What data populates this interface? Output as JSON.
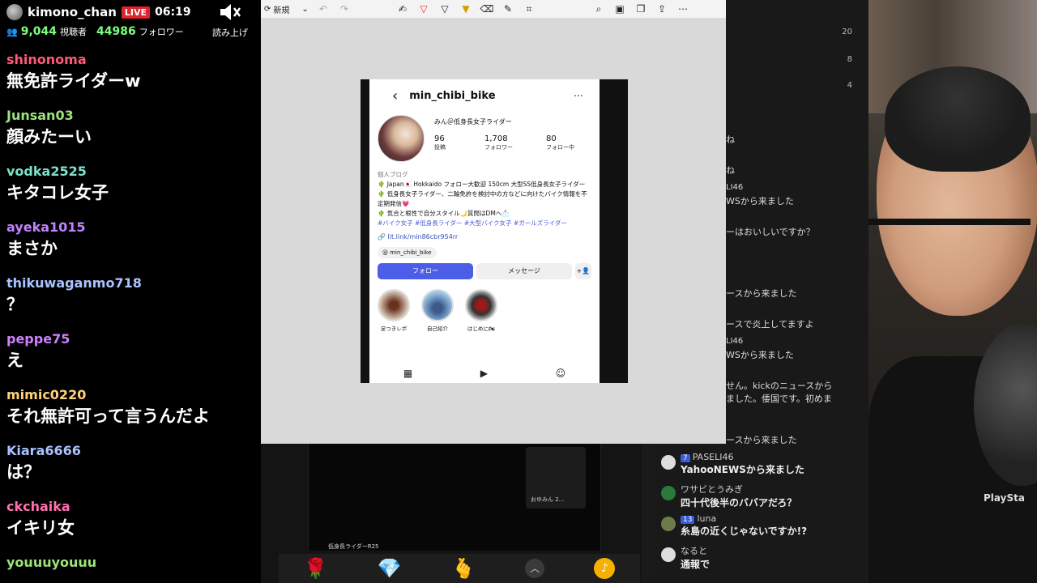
{
  "stream": {
    "streamer_name": "kimono_chan",
    "live_label": "LIVE",
    "elapsed": "06:19",
    "viewers": "9,044",
    "viewers_label": "視聴者",
    "followers": "44986",
    "followers_label": "フォロワー",
    "tts_label": "読み上げ"
  },
  "chat": [
    {
      "user": "shinonoma",
      "color": "#ff5a7a",
      "text": "無免許ライダーw"
    },
    {
      "user": "Junsan03",
      "color": "#9be37a",
      "text": "顔みたーい"
    },
    {
      "user": "vodka2525",
      "color": "#7de0c8",
      "text": "キタコレ女子"
    },
    {
      "user": "ayeka1015",
      "color": "#c080ff",
      "text": "まさか"
    },
    {
      "user": "thikuwaganmo718",
      "color": "#a8c4ff",
      "text": "？"
    },
    {
      "user": "peppe75",
      "color": "#d080ff",
      "text": "え"
    },
    {
      "user": "mimic0220",
      "color": "#ffd27a",
      "text": "それ無許可って言うんだよ"
    },
    {
      "user": "Kiara6666",
      "color": "#a8c4ff",
      "text": "は？"
    },
    {
      "user": "ckchaika",
      "color": "#ff70b0",
      "text": "イキリ女"
    },
    {
      "user": "youuuyouuu",
      "color": "#9be37a",
      "text": "…"
    }
  ],
  "editor": {
    "new_label": "新規",
    "tools": [
      "undo",
      "redo",
      "touch-write",
      "pen-red",
      "pen",
      "highlighter",
      "eraser",
      "pencil",
      "crop",
      "zoom",
      "save",
      "copy",
      "share",
      "more"
    ]
  },
  "instagram": {
    "handle": "min_chibi_bike",
    "display_name": "みん＠低身長女子ライダー",
    "posts": "96",
    "posts_label": "投稿",
    "followers": "1,708",
    "followers_label": "フォロワー",
    "following": "80",
    "following_label": "フォロー中",
    "category": "個人ブログ",
    "bio_lines": [
      "🌵 Japan🇯🇵 Hokkaido フォロー大歓迎 150cm 大型SS低身長女子ライダー",
      "🌵 低身長女子ライダー、二輪免許を検討中の方などに向けたバイク情報を不定期発信💗",
      "🌵 気合と根性で自分スタイル🌙質問はDMへ📩"
    ],
    "hashtags": "#バイク女子 #低身長ライダー #大型バイク女子 #ガールズライダー",
    "link": "lit.link/min86cbr954rr",
    "threads_handle": "min_chibi_bike",
    "follow_button": "フォロー",
    "message_button": "メッセージ",
    "highlights": [
      "足つきレポ",
      "自己紹介",
      "はじめに🏍"
    ]
  },
  "right_chat_faded": {
    "counts": [
      "20",
      "8",
      "4"
    ],
    "lines": [
      "ね",
      "ね",
      "LI46",
      "WSから来ました",
      "ーはおいしいですか？",
      "ースから来ました",
      "ースで炎上してますよ",
      "LI46",
      "WSから来ました",
      "せん。kickのニュースから",
      "ました。倭国です。初めま",
      "ースから来ました"
    ]
  },
  "right_chat": [
    {
      "badge": "7",
      "user": "PASELI46",
      "msg": "YahooNEWSから来ました"
    },
    {
      "badge": "",
      "user": "ワサビとうみぎ",
      "msg": "四十代後半のババアだろ？"
    },
    {
      "badge": "13",
      "user": "luna",
      "msg": "糸島の近くじゃないですか!?"
    },
    {
      "badge": "",
      "user": "なると",
      "msg": "通報で"
    }
  ],
  "video_preview": {
    "caption": "低身長ライダーR25",
    "thumb_text": "おゆみん 2..."
  },
  "webcam": {
    "logo_text": "PlaySta"
  }
}
